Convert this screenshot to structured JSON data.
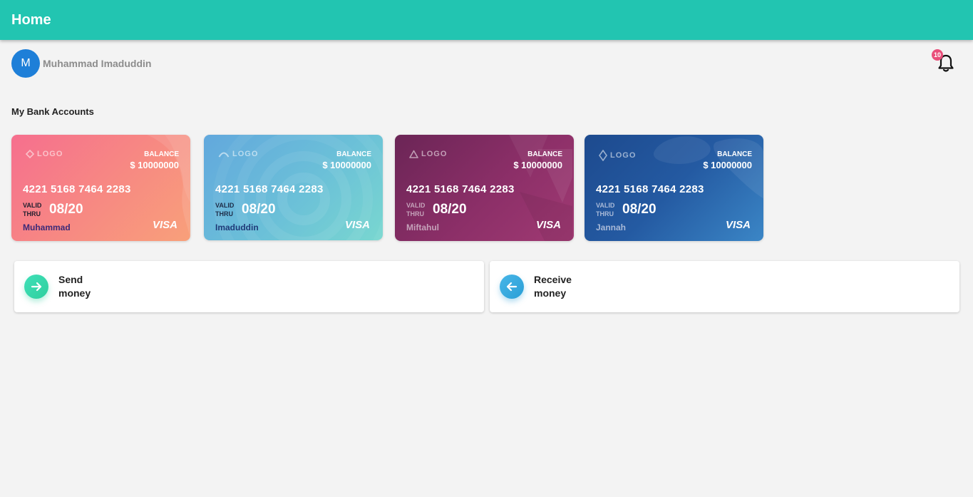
{
  "appbar": {
    "title": "Home"
  },
  "user": {
    "initial": "M",
    "name": "Muhammad Imaduddin"
  },
  "notifications": {
    "count": "10"
  },
  "section_title": "My Bank Accounts",
  "cards": [
    {
      "logo": "LOGO",
      "balance_label": "BALANCE",
      "balance": "$ 10000000",
      "number": "4221 5168 7464 2283",
      "valid_line1": "VALID",
      "valid_line2": "THRU",
      "expiry": "08/20",
      "holder": "Muhammad",
      "brand": "VISA"
    },
    {
      "logo": "LOGO",
      "balance_label": "BALANCE",
      "balance": "$ 10000000",
      "number": "4221 5168 7464 2283",
      "valid_line1": "VALID",
      "valid_line2": "THRU",
      "expiry": "08/20",
      "holder": "Imaduddin",
      "brand": "VISA"
    },
    {
      "logo": "LOGO",
      "balance_label": "BALANCE",
      "balance": "$ 10000000",
      "number": "4221 5168 7464 2283",
      "valid_line1": "VALID",
      "valid_line2": "THRU",
      "expiry": "08/20",
      "holder": "Miftahul",
      "brand": "VISA"
    },
    {
      "logo": "LOGO",
      "balance_label": "BALANCE",
      "balance": "$ 10000000",
      "number": "4221 5168 7464 2283",
      "valid_line1": "VALID",
      "valid_line2": "THRU",
      "expiry": "08/20",
      "holder": "Jannah",
      "brand": "VISA"
    }
  ],
  "actions": {
    "send": {
      "line1": "Send",
      "line2": "money",
      "icon": "arrow-right-icon"
    },
    "receive": {
      "line1": "Receive",
      "line2": "money",
      "icon": "arrow-left-icon"
    }
  },
  "colors": {
    "appbar": "#22c5b1",
    "avatar": "#1e7fd8",
    "badge": "#e94e7a",
    "background": "#f3f3f3"
  }
}
